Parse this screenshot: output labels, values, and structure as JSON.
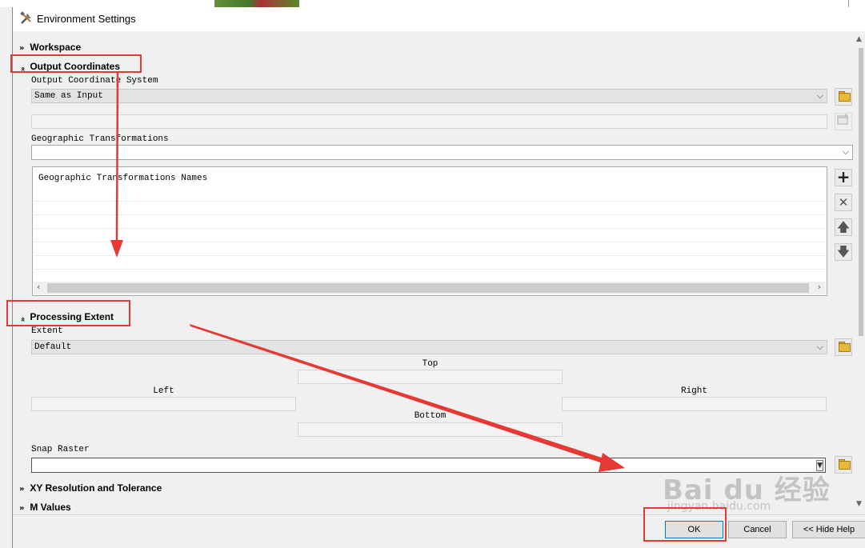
{
  "window": {
    "title": "Environment Settings"
  },
  "sections": {
    "workspace": "Workspace",
    "output_coordinates": "Output Coordinates",
    "processing_extent": "Processing Extent",
    "xy_resolution": "XY Resolution and Tolerance",
    "m_values": "M Values"
  },
  "output_coordinates": {
    "system_label": "Output Coordinate System",
    "system_value": "Same as Input",
    "geo_transform_label": "Geographic Transformations",
    "geo_transform_value": "",
    "list_header": "Geographic Transformations Names"
  },
  "processing_extent": {
    "extent_label": "Extent",
    "extent_value": "Default",
    "top_label": "Top",
    "left_label": "Left",
    "right_label": "Right",
    "bottom_label": "Bottom",
    "snap_raster_label": "Snap Raster",
    "snap_raster_value": ""
  },
  "buttons": {
    "ok": "OK",
    "cancel": "Cancel",
    "hide_help": "<< Hide Help"
  },
  "icons": {
    "titlebar": "tools-icon",
    "browse": "folder-open-icon",
    "properties": "spatial-reference-icon",
    "add": "plus-icon",
    "remove": "x-icon",
    "up": "arrow-up-icon",
    "down": "arrow-down-icon"
  },
  "watermark": {
    "logo": "Bai du 经验",
    "url": "jingyan.baidu.com"
  },
  "colors": {
    "annotation": "#e53935",
    "default_button_border": "#0078d7"
  }
}
